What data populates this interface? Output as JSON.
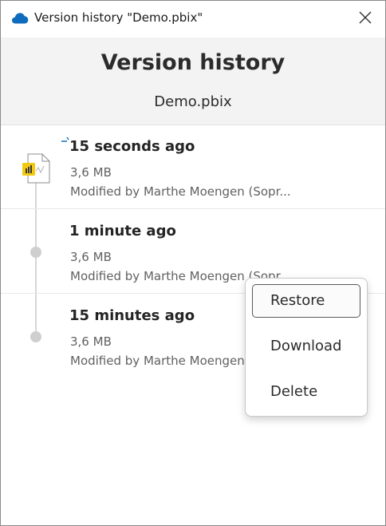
{
  "window": {
    "title": "Version history \"Demo.pbix\""
  },
  "header": {
    "title": "Version history",
    "file_name": "Demo.pbix"
  },
  "versions": [
    {
      "time": "15 seconds ago",
      "size": "3,6 MB",
      "modified": "Modified by Marthe Moengen (Sopr..."
    },
    {
      "time": "1 minute ago",
      "size": "3,6 MB",
      "modified": "Modified by Marthe Moengen (Sopr..."
    },
    {
      "time": "15 minutes ago",
      "size": "3,6 MB",
      "modified": "Modified by Marthe Moengen (Sopr..."
    }
  ],
  "context_menu": {
    "items": [
      {
        "label": "Restore",
        "state": "focused"
      },
      {
        "label": "Download"
      },
      {
        "label": "Delete"
      }
    ]
  },
  "colors": {
    "onedrive_blue": "#0f6cbd",
    "powerbi_yellow": "#f2c811"
  },
  "icons": {
    "app": "onedrive-cloud-icon",
    "close": "close-icon",
    "file": "powerbi-file-icon",
    "progress": "spinner-icon"
  }
}
